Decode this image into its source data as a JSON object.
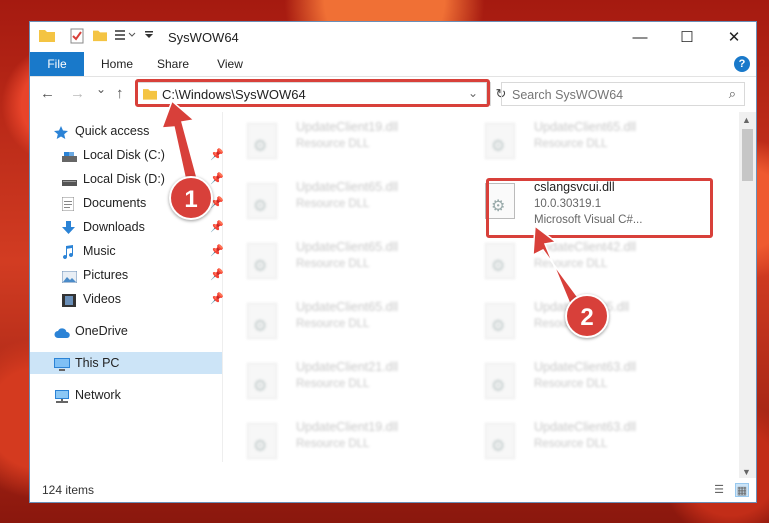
{
  "window": {
    "title": "SysWOW64",
    "controls": {
      "minimize": "—",
      "maximize": "☐",
      "close": "✕"
    }
  },
  "ribbon": {
    "tabs": [
      {
        "label": "File",
        "active": true
      },
      {
        "label": "Home"
      },
      {
        "label": "Share"
      },
      {
        "label": "View"
      }
    ],
    "help": "?"
  },
  "nav": {
    "back": "←",
    "forward": "→",
    "recent": "⌄",
    "up": "↑",
    "address": "C:\\Windows\\SysWOW64",
    "address_chevron": "⌄",
    "refresh": "↻",
    "search_placeholder": "Search SysWOW64",
    "search_icon": "⌕"
  },
  "sidebar": {
    "items": [
      {
        "label": "Quick access",
        "icon": "star-icon",
        "pinned": false
      },
      {
        "label": "Local Disk (C:)",
        "icon": "drive-icon",
        "pinned": true
      },
      {
        "label": "Local Disk (D:)",
        "icon": "drive-icon",
        "pinned": true
      },
      {
        "label": "Documents",
        "icon": "document-icon",
        "pinned": true
      },
      {
        "label": "Downloads",
        "icon": "download-icon",
        "pinned": true
      },
      {
        "label": "Music",
        "icon": "music-icon",
        "pinned": true
      },
      {
        "label": "Pictures",
        "icon": "picture-icon",
        "pinned": true
      },
      {
        "label": "Videos",
        "icon": "video-icon",
        "pinned": true
      },
      {
        "label": "OneDrive",
        "icon": "cloud-icon",
        "pinned": false
      },
      {
        "label": "This PC",
        "icon": "computer-icon",
        "pinned": false,
        "selected": true
      },
      {
        "label": "Network",
        "icon": "network-icon",
        "pinned": false
      }
    ],
    "pin_glyph": "📌"
  },
  "files": {
    "left": [
      {
        "name": "UpdateClient19.dll",
        "desc": "Resource DLL"
      },
      {
        "name": "UpdateClient65.dll",
        "desc": "Resource DLL"
      },
      {
        "name": "UpdateClient65.dll",
        "desc": "Resource DLL"
      },
      {
        "name": "UpdateClient65.dll",
        "desc": "Resource DLL"
      },
      {
        "name": "UpdateClient21.dll",
        "desc": "Resource DLL"
      },
      {
        "name": "UpdateClient19.dll",
        "desc": "Resource DLL"
      }
    ],
    "right": [
      {
        "name": "UpdateClient65.dll",
        "desc": "Resource DLL"
      },
      {
        "name": "UpdateClient42.dll",
        "desc": "Resource DLL"
      },
      {
        "name": "UpdateClient5.dll",
        "desc": "Resource DLL"
      },
      {
        "name": "UpdateClient63.dll",
        "desc": "Resource DLL"
      },
      {
        "name": "UpdateClient63.dll",
        "desc": "Resource DLL"
      }
    ],
    "highlighted": {
      "name": "cslangsvcui.dll",
      "version": "10.0.30319.1",
      "desc": "Microsoft Visual C#..."
    }
  },
  "status": {
    "count": "124 items"
  },
  "callouts": {
    "one": "1",
    "two": "2",
    "color": "#d8403a"
  }
}
